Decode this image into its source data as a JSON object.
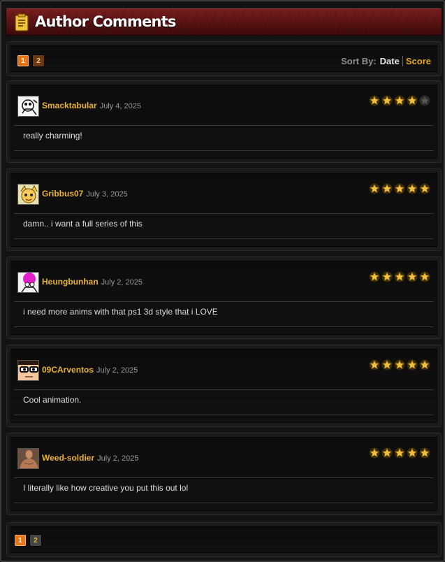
{
  "header": {
    "title": "Author Comments",
    "icon": "notepad-icon"
  },
  "pagination": {
    "pages": [
      "1",
      "2"
    ],
    "current": "1"
  },
  "sort": {
    "label": "Sort By:",
    "options": [
      "Date",
      "Score"
    ],
    "active": "Score"
  },
  "colors": {
    "accent": "#e8a81c",
    "username": "#e8b234",
    "header_red": "#6b1818",
    "star_gold": "#f0c040"
  },
  "comments": [
    {
      "username": "Smacktabular",
      "date": "July 4, 2025",
      "text": "really charming!",
      "rating": 4,
      "max_rating": 5
    },
    {
      "username": "Gribbus07",
      "date": "July 3, 2025",
      "text": "damn.. i want a full series of this",
      "rating": 5,
      "max_rating": 5
    },
    {
      "username": "Heungbunhan",
      "date": "July 2, 2025",
      "text": "i need more anims with that ps1 3d style that i LOVE",
      "rating": 5,
      "max_rating": 5
    },
    {
      "username": "09CArventos",
      "date": "July 2, 2025",
      "text": "Cool animation.",
      "rating": 5,
      "max_rating": 5
    },
    {
      "username": "Weed-soldier",
      "date": "July 2, 2025",
      "text": "I literally like how creative you put this out lol",
      "rating": 5,
      "max_rating": 5
    }
  ]
}
